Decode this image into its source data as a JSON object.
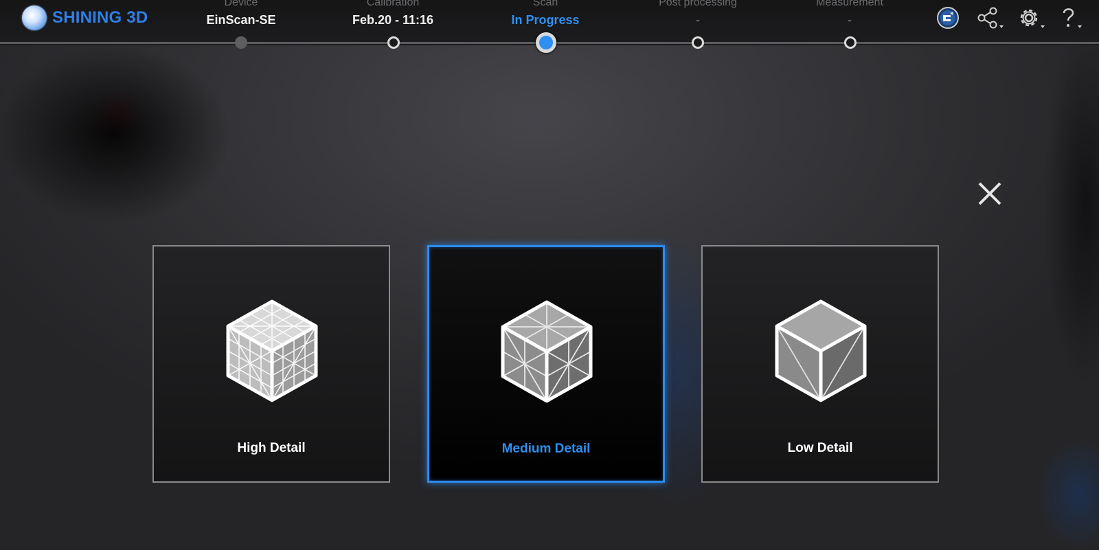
{
  "app": {
    "brand": "SHINING 3D"
  },
  "steps": [
    {
      "label": "Device",
      "value": "EinScan-SE",
      "state": "done"
    },
    {
      "label": "Calibration",
      "value": "Feb.20 - 11:16",
      "state": "done"
    },
    {
      "label": "Scan",
      "value": "In Progress",
      "state": "current"
    },
    {
      "label": "Post processing",
      "value": "-",
      "state": "pending"
    },
    {
      "label": "Measurement",
      "value": "-",
      "state": "pending"
    }
  ],
  "toolbar": {
    "icons": [
      "ek-model-icon",
      "share-icon",
      "gear-icon",
      "help-icon"
    ]
  },
  "options": [
    {
      "label": "High Detail",
      "selected": false
    },
    {
      "label": "Medium Detail",
      "selected": true
    },
    {
      "label": "Low Detail",
      "selected": false
    }
  ],
  "colors": {
    "accent": "#2f8ff0",
    "brand": "#2f7fe6",
    "card_border": "#8a8a8c"
  }
}
